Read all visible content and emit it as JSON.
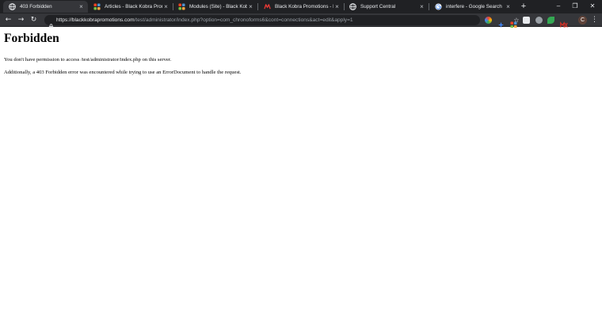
{
  "tabs": [
    {
      "title": "403 Forbidden",
      "favicon": "globe-icon",
      "active": true
    },
    {
      "title": "Articles - Black Kobra Promo",
      "favicon": "joomla-icon",
      "active": false
    },
    {
      "title": "Modules (Site) - Black Kobra",
      "favicon": "joomla-icon",
      "active": false
    },
    {
      "title": "Black Kobra Promotions - Bl",
      "favicon": "kobra-icon",
      "active": false
    },
    {
      "title": "Support Central",
      "favicon": "globe-icon",
      "active": false
    },
    {
      "title": "interfere - Google Search",
      "favicon": "google-icon",
      "active": false
    }
  ],
  "tab_close_glyph": "×",
  "new_tab_glyph": "+",
  "window_controls": {
    "minimize": "–",
    "maximize": "❐",
    "close": "✕"
  },
  "toolbar": {
    "back_glyph": "←",
    "forward_glyph": "→",
    "reload_glyph": "↻",
    "star_glyph": "☆",
    "menu_glyph": "⋮"
  },
  "address_bar": {
    "host_text": "https://blackkobrapromotions.com",
    "path_text": "/test/administrator/index.php?option=com_chronoforms6&cont=connections&act=edit&apply=1"
  },
  "extensions": [
    {
      "name": "colorwheel-extension-icon",
      "color": "#e94235"
    },
    {
      "name": "sparkle-extension-icon",
      "color": "#4285f4"
    },
    {
      "name": "joomla-extension-icon",
      "color": "#f4a32a"
    },
    {
      "name": "screenshot-extension-icon",
      "color": "#e8eaed"
    },
    {
      "name": "badge-extension-icon",
      "color": "#9aa0a6"
    },
    {
      "name": "leaf-extension-icon",
      "color": "#34a853"
    },
    {
      "name": "mx-extension-icon",
      "color": "#d93025"
    }
  ],
  "profile_initial": "C",
  "page": {
    "heading": "Forbidden",
    "line1": "You don't have permission to access /test/administrator/index.php on this server.",
    "line2": "Additionally, a 403 Forbidden error was encountered while trying to use an ErrorDocument to handle the request."
  }
}
